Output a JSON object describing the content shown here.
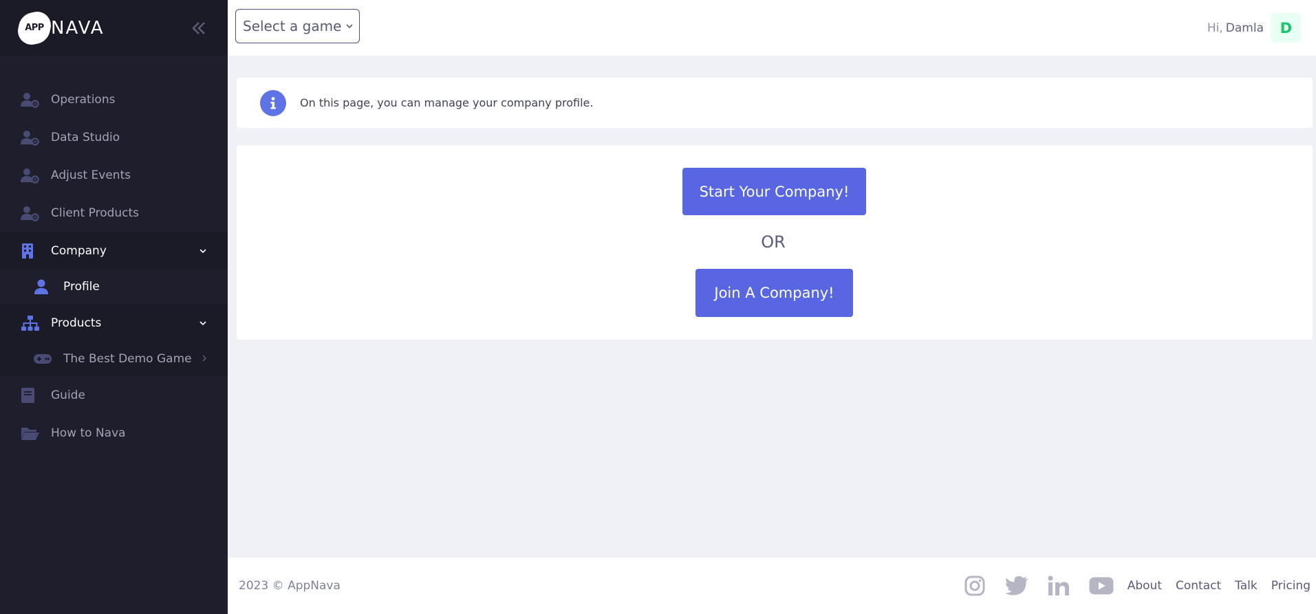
{
  "brand": {
    "logo_badge": "APP",
    "logo_text": "NAVA"
  },
  "sidebar": {
    "items": [
      {
        "label": "Operations",
        "icon": "users-cog-icon"
      },
      {
        "label": "Data Studio",
        "icon": "users-cog-icon"
      },
      {
        "label": "Adjust Events",
        "icon": "users-cog-icon"
      },
      {
        "label": "Client Products",
        "icon": "users-cog-icon"
      },
      {
        "label": "Company",
        "icon": "building-icon"
      },
      {
        "label": "Profile",
        "icon": "user-icon"
      },
      {
        "label": "Products",
        "icon": "sitemap-icon"
      },
      {
        "label": "The Best Demo Game",
        "icon": "gamepad-icon"
      },
      {
        "label": "Guide",
        "icon": "book-icon"
      },
      {
        "label": "How to Nava",
        "icon": "folder-open-icon"
      }
    ]
  },
  "topbar": {
    "game_select": "Select a game",
    "greeting": "Hi,",
    "user_name": "Damla",
    "avatar_letter": "D"
  },
  "info": {
    "text": "On this page, you can manage your company profile."
  },
  "main": {
    "start_button": "Start Your Company!",
    "or_text": "OR",
    "join_button": "Join A Company!"
  },
  "footer": {
    "copyright": "2023 © AppNava",
    "social_icons": [
      "instagram-icon",
      "twitter-icon",
      "linkedin-icon",
      "youtube-icon"
    ],
    "links": [
      "About",
      "Contact",
      "Talk",
      "Pricing"
    ]
  },
  "colors": {
    "sidebar_bg": "#1e1e2d",
    "accent": "#5866e1",
    "info_icon": "#5d73e6",
    "avatar_text": "#1bc56a"
  }
}
